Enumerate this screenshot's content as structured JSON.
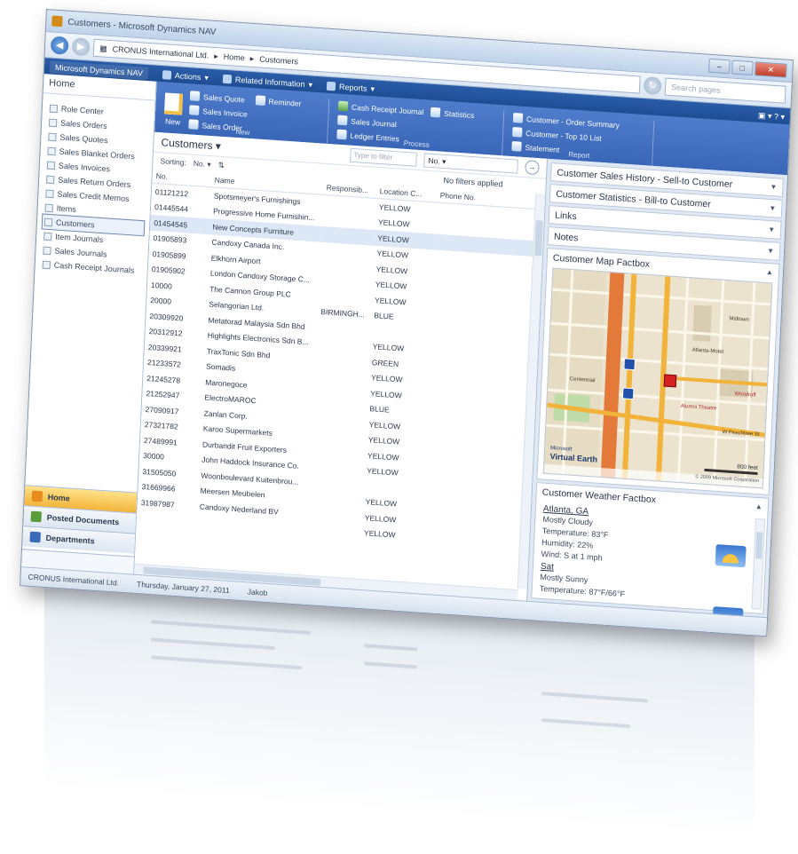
{
  "window": {
    "title": "Customers - Microsoft Dynamics NAV"
  },
  "address": {
    "crumbs": [
      "CRONUS International Ltd.",
      "Home",
      "Customers"
    ],
    "search_placeholder": "Search pages"
  },
  "menubar": {
    "app": "Microsoft Dynamics NAV",
    "items": [
      "Actions",
      "Related Information",
      "Reports"
    ]
  },
  "ribbon": {
    "new": {
      "big": "New",
      "items": [
        "Sales Quote",
        "Sales Invoice",
        "Sales Order"
      ],
      "reminder": "Reminder",
      "label": "New"
    },
    "process": {
      "items": [
        "Cash Receipt Journal",
        "Sales Journal",
        "Ledger Entries"
      ],
      "statistics": "Statistics",
      "label": "Process"
    },
    "report": {
      "items": [
        "Customer - Order Summary",
        "Customer - Top 10 List",
        "Statement"
      ],
      "label": "Report"
    }
  },
  "nav": {
    "home": "Home",
    "items": [
      "Role Center",
      "Sales Orders",
      "Sales Quotes",
      "Sales Blanket Orders",
      "Sales Invoices",
      "Sales Return Orders",
      "Sales Credit Memos",
      "Items",
      "Customers",
      "Item Journals",
      "Sales Journals",
      "Cash Receipt Journals"
    ],
    "active_index": 8,
    "buttons": [
      "Home",
      "Posted Documents",
      "Departments"
    ]
  },
  "list": {
    "title": "Customers",
    "type_filter_placeholder": "Type to filter",
    "filter_field": "No.",
    "sorting_label": "Sorting:",
    "sorting_value": "No.",
    "no_filters": "No filters applied",
    "columns": [
      "No.",
      "Name",
      "Responsib...",
      "Location C...",
      "Phone No."
    ],
    "rows": [
      [
        "01121212",
        "Spotsmeyer's Furnishings",
        "",
        "YELLOW",
        ""
      ],
      [
        "01445544",
        "Progressive Home Furnishin...",
        "",
        "YELLOW",
        ""
      ],
      [
        "01454545",
        "New Concepts Furniture",
        "",
        "YELLOW",
        ""
      ],
      [
        "01905893",
        "Candoxy Canada Inc.",
        "",
        "YELLOW",
        ""
      ],
      [
        "01905899",
        "Elkhorn Airport",
        "",
        "YELLOW",
        ""
      ],
      [
        "01905902",
        "London Candoxy Storage C...",
        "",
        "YELLOW",
        ""
      ],
      [
        "10000",
        "The Cannon Group PLC",
        "",
        "YELLOW",
        ""
      ],
      [
        "20000",
        "Selangorian Ltd.",
        "BIRMINGH...",
        "BLUE",
        ""
      ],
      [
        "20309920",
        "Metatorad Malaysia Sdn Bhd",
        "",
        "",
        ""
      ],
      [
        "20312912",
        "Highlights Electronics Sdn B...",
        "",
        "YELLOW",
        ""
      ],
      [
        "20339921",
        "TraxTonic Sdn Bhd",
        "",
        "GREEN",
        ""
      ],
      [
        "21233572",
        "Somadis",
        "",
        "YELLOW",
        ""
      ],
      [
        "21245278",
        "Maronegoce",
        "",
        "YELLOW",
        ""
      ],
      [
        "21252947",
        "ElectroMAROC",
        "",
        "BLUE",
        ""
      ],
      [
        "27090917",
        "Zanlan Corp.",
        "",
        "YELLOW",
        ""
      ],
      [
        "27321782",
        "Karoo Supermarkets",
        "",
        "YELLOW",
        ""
      ],
      [
        "27489991",
        "Durbandit Fruit Exporters",
        "",
        "YELLOW",
        ""
      ],
      [
        "30000",
        "John Haddock Insurance Co.",
        "",
        "YELLOW",
        ""
      ],
      [
        "31505050",
        "Woonboulevard Kuitenbrou...",
        "",
        "",
        ""
      ],
      [
        "31669966",
        "Meersen Meubelen",
        "",
        "YELLOW",
        ""
      ],
      [
        "31987987",
        "Candoxy Nederland BV",
        "",
        "YELLOW",
        ""
      ],
      [
        "",
        "",
        "",
        "YELLOW",
        ""
      ]
    ],
    "selected_index": 2
  },
  "factboxes": {
    "sales_history": "Customer Sales History - Sell-to Customer",
    "statistics": "Customer Statistics - Bill-to Customer",
    "links": "Links",
    "notes": "Notes",
    "map": {
      "title": "Customer Map Factbox",
      "brand": "Virtual Earth",
      "brand_prefix": "Microsoft",
      "scale_label": "800 feet",
      "copyright": "© 2009 Microsoft Corporation",
      "labels": [
        "Atlanta-Motel",
        "Alumni Theatre",
        "Woodruff",
        "Midtown",
        "Centennial",
        "W Peachtree St"
      ]
    },
    "weather": {
      "title": "Customer Weather Factbox",
      "city": "Atlanta, GA",
      "condition": "Mostly Cloudy",
      "temperature": "Temperature: 83°F",
      "humidity": "Humidity: 22%",
      "wind": "Wind: S at 1 mph",
      "day": "Sat",
      "day_condition": "Mostly Sunny",
      "day_temp": "Temperature: 87°F/66°F"
    }
  },
  "statusbar": {
    "company": "CRONUS International Ltd.",
    "date": "Thursday, January 27, 2011",
    "user": "Jakob"
  }
}
